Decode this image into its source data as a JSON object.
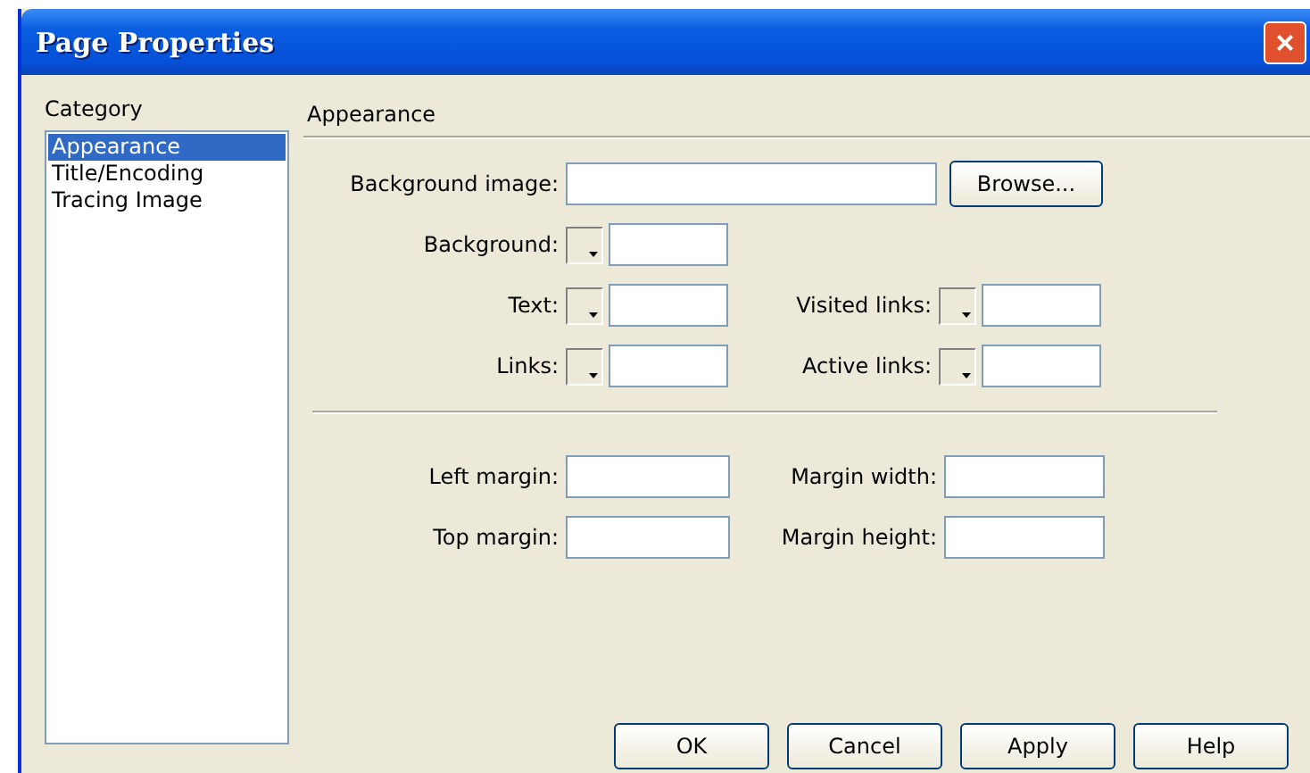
{
  "window": {
    "title": "Page Properties",
    "close": "×"
  },
  "category": {
    "label": "Category",
    "items": [
      {
        "label": "Appearance",
        "selected": true
      },
      {
        "label": "Title/Encoding",
        "selected": false
      },
      {
        "label": "Tracing Image",
        "selected": false
      }
    ]
  },
  "panel": {
    "title": "Appearance",
    "background_image": {
      "label": "Background image:",
      "button": "Browse..."
    },
    "color_rows": [
      [
        {
          "label": "Background:"
        }
      ],
      [
        {
          "label": "Text:"
        },
        {
          "label": "Visited links:"
        }
      ],
      [
        {
          "label": "Links:"
        },
        {
          "label": "Active links:"
        }
      ]
    ],
    "margin_rows": [
      [
        {
          "label": "Left margin:"
        },
        {
          "label": "Margin width:"
        }
      ],
      [
        {
          "label": "Top margin:"
        },
        {
          "label": "Margin height:"
        }
      ]
    ]
  },
  "buttons": [
    "OK",
    "Cancel",
    "Apply",
    "Help"
  ]
}
